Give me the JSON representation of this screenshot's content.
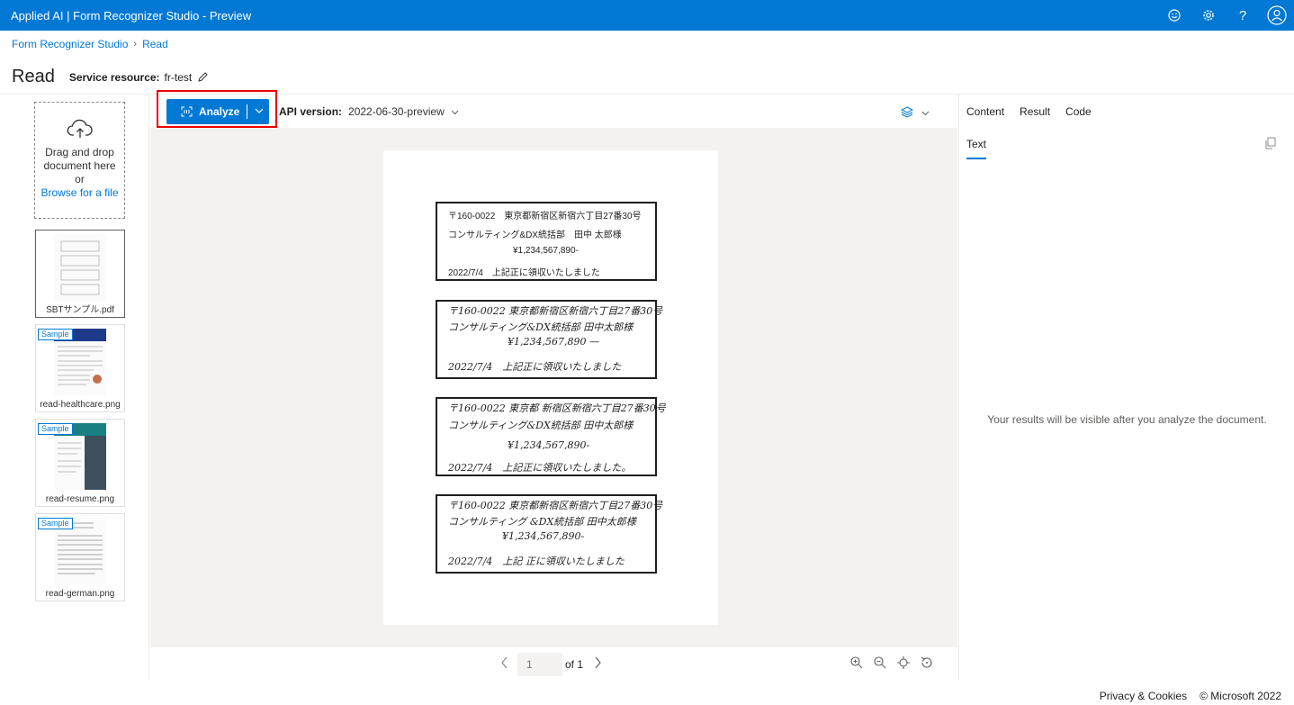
{
  "app": {
    "title": "Applied AI | Form Recognizer Studio - Preview"
  },
  "topbar_icons": [
    "smiley-icon",
    "gear-icon",
    "help-icon",
    "user-avatar-icon"
  ],
  "topbar_help_glyph": "?",
  "breadcrumb": {
    "root": "Form Recognizer Studio",
    "current": "Read"
  },
  "page": {
    "title": "Read",
    "service_label": "Service resource:",
    "service_value": "fr-test"
  },
  "dropzone": {
    "line1": "Drag and drop",
    "line2": "document here",
    "line3": "or",
    "browse": "Browse for a file"
  },
  "files": [
    {
      "name": "SBTサンプル.pdf",
      "sample": ""
    },
    {
      "name": "read-healthcare.png",
      "sample": "Sample"
    },
    {
      "name": "read-resume.png",
      "sample": "Sample"
    },
    {
      "name": "read-german.png",
      "sample": "Sample"
    }
  ],
  "toolbar": {
    "analyze_label": "Analyze",
    "api_label": "API version:",
    "api_value": "2022-06-30-preview"
  },
  "document": {
    "receipts": [
      {
        "l1": "〒160-0022　東京都新宿区新宿六丁目27番30号",
        "l2": "コンサルティング&DX統括部　田中 太郎様",
        "l3": "¥1,234,567,890-",
        "l4": "2022/7/4　上記正に領収いたしました"
      },
      {
        "l1": "〒160-0022 東京都新宿区新宿六丁目27番30号",
        "l2": "コンサルティング&DX統括部 田中太郎様",
        "l3": "¥1,234,567,890 —",
        "l4": "2022/7/4　上記正に領収いたしました"
      },
      {
        "l1": "〒160-0022 東京都 新宿区新宿六丁目27番30号",
        "l2": "コンサルティング&DX統括部 田中太郎様",
        "l3": "¥1,234,567,890-",
        "l4": "2022/7/4　上記正に領収いたしました。"
      },
      {
        "l1": "〒160-0022 東京都新宿区新宿六丁目27番30号",
        "l2": "コンサルティング &DX統括部 田中太郎様",
        "l3": "¥1,234,567,890-",
        "l4": "2022/7/4　上記 正に領収いたしました"
      }
    ]
  },
  "pager": {
    "page_placeholder": "1",
    "of_text": "of 1"
  },
  "right_panel": {
    "tabs": [
      "Content",
      "Result",
      "Code"
    ],
    "subtab": "Text",
    "empty_message": "Your results will be visible after you analyze the document."
  },
  "footer": {
    "privacy": "Privacy & Cookies",
    "copyright": "© Microsoft 2022"
  },
  "colors": {
    "brand": "#0078d4",
    "highlight": "#ee0000"
  }
}
